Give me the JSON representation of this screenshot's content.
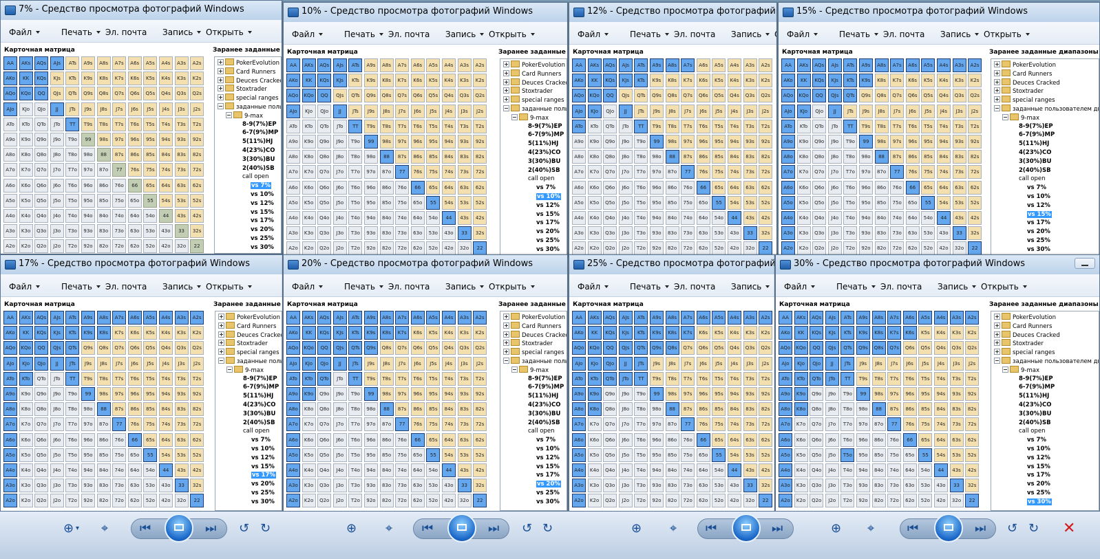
{
  "menu": [
    "Файл",
    "Печать",
    "Эл. почта",
    "Запись",
    "Открыть"
  ],
  "matrix_title": "Карточная матрица",
  "panel_title": "Заранее заданные диапазоны ручные",
  "tree_groups": [
    "PokerEvolution",
    "Card Runners",
    "Deuces Cracked",
    "Stoxtrader",
    "special ranges",
    "заданные пользователем диапазоны"
  ],
  "tree_sub": "9-max",
  "tree_open": [
    "8-9(7%)EP",
    "6-7(9%)MP",
    "5(11%)HJ",
    "4(23%)CO",
    "3(30%)BU",
    "2(40%)SB"
  ],
  "tree_call": "call open",
  "tree_vs": [
    "vs 7%",
    "vs 10%",
    "vs 12%",
    "vs 15%",
    "vs 17%",
    "vs 20%",
    "vs 25%",
    "vs 30%"
  ],
  "ranks": [
    "A",
    "K",
    "Q",
    "J",
    "T",
    "9",
    "8",
    "7",
    "6",
    "5",
    "4",
    "3",
    "2"
  ],
  "windows": [
    {
      "title": "7% - Средство просмотра фотографий Windows",
      "selected": "vs 7%"
    },
    {
      "title": "10% - Средство просмотра фотографий Windows",
      "selected": "vs 10%"
    },
    {
      "title": "12% - Средство просмотра фотографий Windows",
      "selected": "vs 12%"
    },
    {
      "title": "15% - Средство просмотра фотографий Windows",
      "selected": "vs 15%"
    },
    {
      "title": "17% - Средство просмотра фотографий Windows",
      "selected": "vs 17%"
    },
    {
      "title": "20% - Средство просмотра фотографий Windows",
      "selected": "vs 20%"
    },
    {
      "title": "25% - Средство просмотра фотографий Windows",
      "selected": "vs 25%"
    },
    {
      "title": "30% - Средство просмотра фотографий Windows",
      "selected": "vs 30%"
    }
  ],
  "viewer_controls": [
    "zoom-icon",
    "zoom-dropdown-icon",
    "actual-size-icon",
    "previous-icon",
    "slideshow-icon",
    "next-icon",
    "rotate-left-icon",
    "rotate-right-icon",
    "delete-icon"
  ]
}
